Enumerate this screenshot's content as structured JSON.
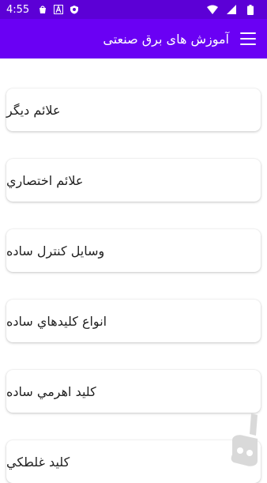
{
  "status_bar": {
    "time": "4:55",
    "icons": [
      "shopping-bag-icon",
      "a-icon",
      "shield-icon",
      "wifi-icon",
      "signal-icon",
      "battery-icon"
    ]
  },
  "app_bar": {
    "title": "آموزش های برق صنعتی",
    "menu_icon": "hamburger-menu-icon"
  },
  "list": {
    "items": [
      {
        "label": "علائم دیگر"
      },
      {
        "label": "علائم اختصاري"
      },
      {
        "label": "وسايل كنترل ساده"
      },
      {
        "label": "انواع كليدهاي ساده"
      },
      {
        "label": "كليد اهرمي ساده"
      },
      {
        "label": "كليد غلطكي"
      }
    ]
  },
  "colors": {
    "status_bar": "#5c00d6",
    "app_bar": "#6a00f4",
    "card": "#ffffff"
  }
}
